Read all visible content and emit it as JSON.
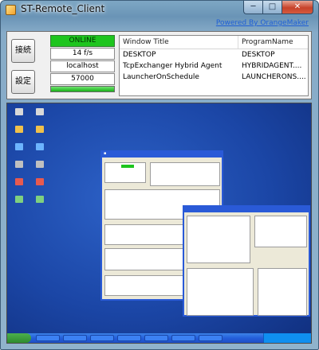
{
  "window": {
    "title": "ST-Remote_Client",
    "powered_link": "Powered By OrangeMaker",
    "controls": {
      "minimize": "─",
      "maximize": "□",
      "close": "✕"
    }
  },
  "toolbar": {
    "connect_label": "接続",
    "settings_label": "設定"
  },
  "status": {
    "connection": "ONLINE",
    "fps": "14 f/s",
    "host": "localhost",
    "port": "57000",
    "progress": 1.0
  },
  "window_list": {
    "columns": [
      "Window Title",
      "ProgramName"
    ],
    "rows": [
      {
        "title": "DESKTOP",
        "program": "DESKTOP"
      },
      {
        "title": "TcpExchanger Hybrid Agent",
        "program": "HYBRIDAGENT...."
      },
      {
        "title": "LauncherOnSchedule",
        "program": "LAUNCHERONS...."
      }
    ]
  },
  "colors": {
    "online": "#1ec51e",
    "link": "#1f5fd6",
    "desktop": "#1b46a6"
  },
  "remote_view": {
    "desktop_icons": [
      {
        "icon": "computer-icon"
      },
      {
        "icon": "folder-icon"
      },
      {
        "icon": "network-icon"
      },
      {
        "icon": "recycle-bin-icon"
      },
      {
        "icon": "app-icon"
      },
      {
        "icon": "app-icon"
      },
      {
        "icon": "app-icon"
      },
      {
        "icon": "app-icon"
      },
      {
        "icon": "app-icon"
      },
      {
        "icon": "app-icon"
      },
      {
        "icon": "app-icon"
      },
      {
        "icon": "app-icon"
      }
    ]
  }
}
